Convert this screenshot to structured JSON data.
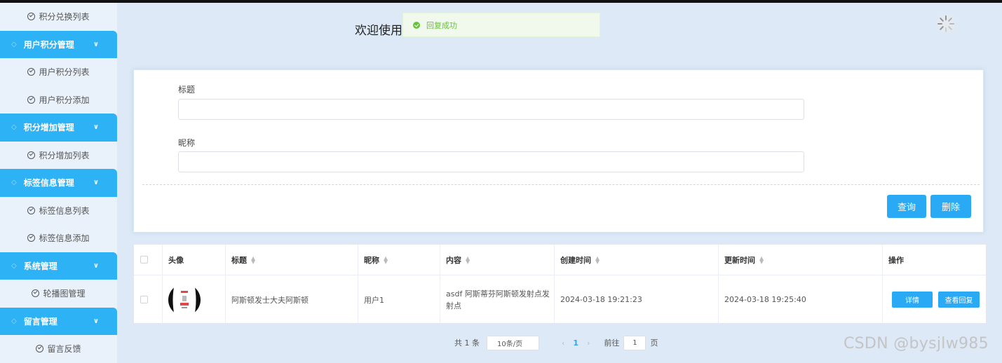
{
  "sidebar": {
    "items": [
      {
        "type": "item",
        "label": "积分兑换列表"
      },
      {
        "type": "group",
        "label": "用户积分管理"
      },
      {
        "type": "item",
        "label": "用户积分列表"
      },
      {
        "type": "item",
        "label": "用户积分添加"
      },
      {
        "type": "group",
        "label": "积分增加管理"
      },
      {
        "type": "item",
        "label": "积分增加列表"
      },
      {
        "type": "group",
        "label": "标签信息管理"
      },
      {
        "type": "item",
        "label": "标签信息列表"
      },
      {
        "type": "item",
        "label": "标签信息添加"
      },
      {
        "type": "group",
        "label": "系统管理"
      },
      {
        "type": "item",
        "label": "轮播图管理"
      },
      {
        "type": "group",
        "label": "留言管理"
      },
      {
        "type": "item",
        "label": "留言反馈"
      }
    ]
  },
  "header": {
    "welcome": "欢迎使用",
    "toast": "回复成功"
  },
  "form": {
    "title_label": "标题",
    "title_value": "",
    "nickname_label": "昵称",
    "nickname_value": "",
    "query_button": "查询",
    "delete_button": "删除"
  },
  "table": {
    "columns": [
      "头像",
      "标题",
      "昵称",
      "内容",
      "创建时间",
      "更新时间",
      "操作"
    ],
    "rows": [
      {
        "title": "阿斯顿发士大夫阿斯顿",
        "nickname": "用户1",
        "content": "asdf 阿斯蒂芬阿斯顿发射点发射点",
        "created": "2024-03-18 19:21:23",
        "updated": "2024-03-18 19:25:40",
        "detail_button": "详情",
        "reply_button": "查看回复"
      }
    ]
  },
  "pagination": {
    "total": "共 1 条",
    "page_size": "10条/页",
    "current_page": "1",
    "goto_label": "前往",
    "goto_value": "1",
    "page_suffix": "页"
  },
  "watermark": "CSDN @bysjlw985",
  "colors": {
    "accent": "#2aa9f4",
    "sidebar_group": "#2db2f5",
    "success": "#67c23a",
    "page_bg": "#dde9f6"
  }
}
